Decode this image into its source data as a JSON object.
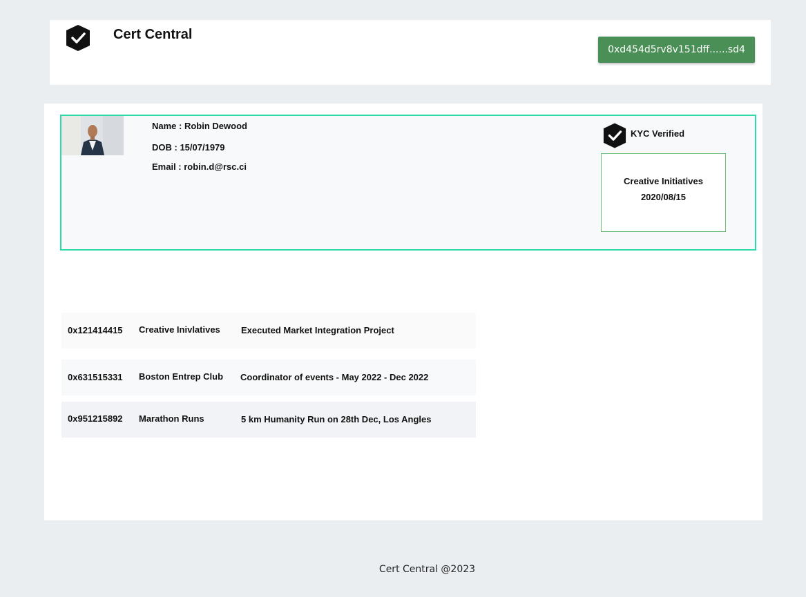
{
  "header": {
    "app_title": "Cert Central",
    "logo_icon": "shield-check-icon",
    "wallet_address": "0xd454d5rv8v151dff......sd4",
    "wallet_color": "#4a8f55"
  },
  "profile": {
    "name": "Name : Robin Dewood",
    "dob": "DOB : 15/07/1979",
    "email": "Email : robin.d@rsc.ci",
    "avatar": "profile-photo",
    "kyc_icon": "shield-check-icon",
    "kyc_label": "KYC Verified",
    "certificate": {
      "organization": "Creative Initiatives",
      "date": "2020/08/15"
    },
    "border_color": "#2fd9a8"
  },
  "records": [
    {
      "id": "0x121414415",
      "organization": "Creative Inivlatives",
      "description": "Executed Market Integration Project",
      "bg": "#fafafa"
    },
    {
      "id": "0x631515331",
      "organization": "Boston Entrep Club",
      "description": "Coordinator of events - May 2022 - Dec 2022",
      "bg": "#f8f9fa"
    },
    {
      "id": "0x951215892",
      "organization": "Marathon Runs",
      "description": "5 km Humanity Run on 28th Dec,  Los Angles",
      "bg": "#f1f3f6"
    }
  ],
  "footer": {
    "text": "Cert Central @2023"
  }
}
